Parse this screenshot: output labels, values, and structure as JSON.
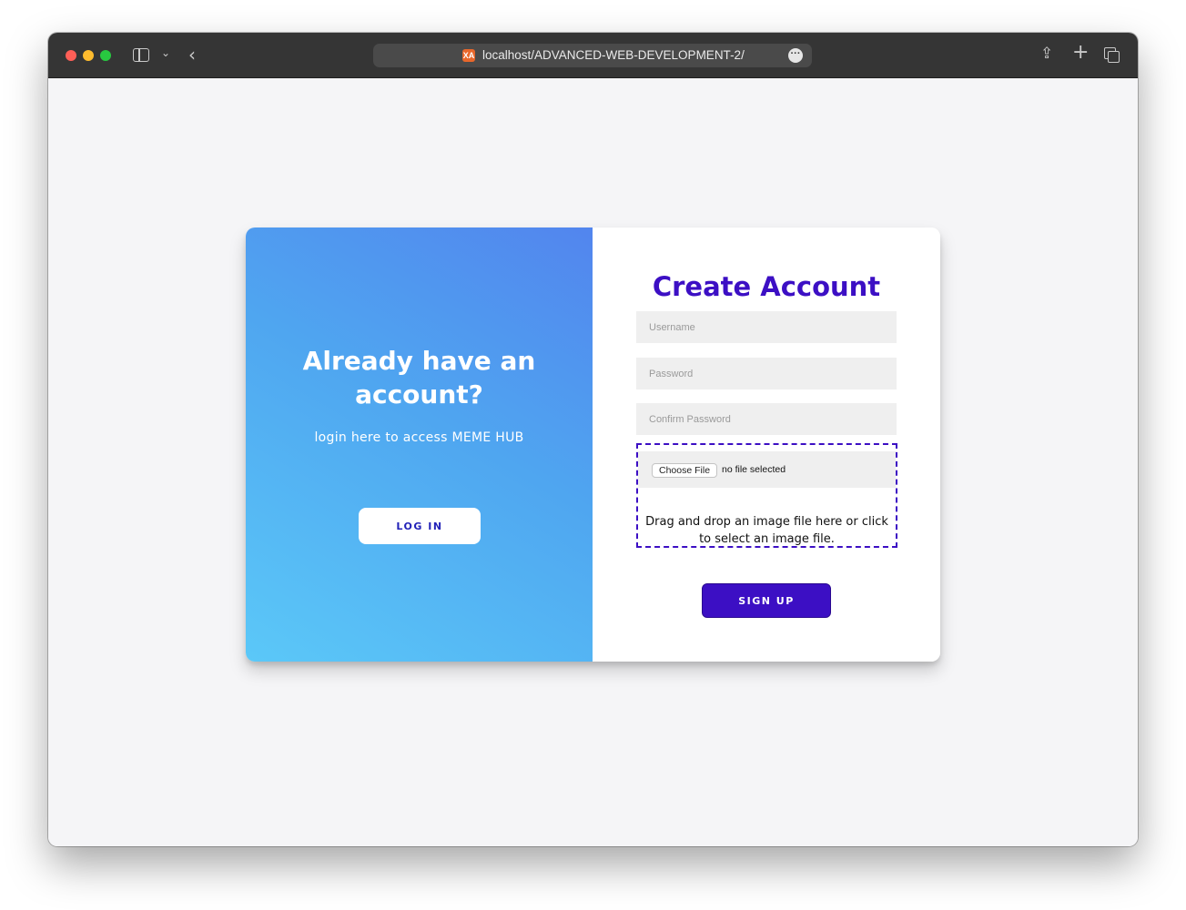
{
  "browser": {
    "url": "localhost/ADVANCED-WEB-DEVELOPMENT-2/",
    "favicon_label": "XA"
  },
  "left_panel": {
    "title": "Already have an account?",
    "subtitle": "login here to access MEME HUB",
    "login_button": "LOG IN"
  },
  "right_panel": {
    "title": "Create Account",
    "username_placeholder": "Username",
    "password_placeholder": "Password",
    "confirm_placeholder": "Confirm Password",
    "choose_file_label": "Choose File",
    "file_status": "no file selected",
    "drop_text": "Drag and drop an image file here or click to select an image file.",
    "signup_button": "SIGN UP"
  },
  "colors": {
    "accent": "#3c0fc4",
    "gradient_start": "#5bc8f8",
    "gradient_end": "#5285ee"
  }
}
